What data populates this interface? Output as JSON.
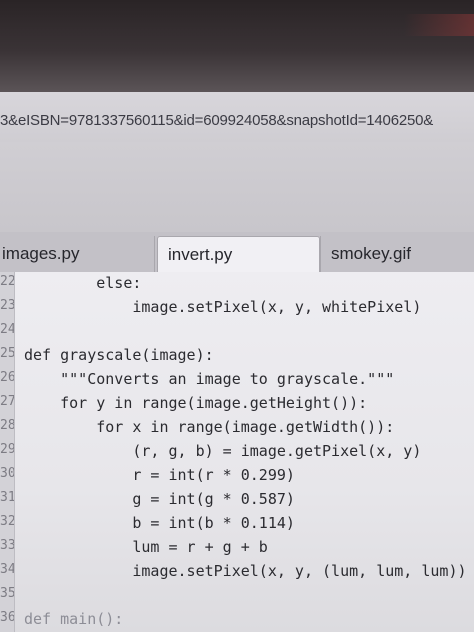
{
  "url": {
    "text": "3&eISBN=9781337560115&id=609924058&snapshotId=1406250&"
  },
  "tabs": [
    {
      "label": "images.py"
    },
    {
      "label": "invert.py"
    },
    {
      "label": "smokey.gif"
    }
  ],
  "editor": {
    "active_tab": "invert.py",
    "lines": [
      {
        "num": "22",
        "text": "        else:"
      },
      {
        "num": "23",
        "text": "            image.setPixel(x, y, whitePixel)"
      },
      {
        "num": "24",
        "text": ""
      },
      {
        "num": "25",
        "text": "def grayscale(image):"
      },
      {
        "num": "26",
        "text": "    \"\"\"Converts an image to grayscale.\"\"\""
      },
      {
        "num": "27",
        "text": "    for y in range(image.getHeight()):"
      },
      {
        "num": "28",
        "text": "        for x in range(image.getWidth()):"
      },
      {
        "num": "29",
        "text": "            (r, g, b) = image.getPixel(x, y)"
      },
      {
        "num": "30",
        "text": "            r = int(r * 0.299)"
      },
      {
        "num": "31",
        "text": "            g = int(g * 0.587)"
      },
      {
        "num": "32",
        "text": "            b = int(b * 0.114)"
      },
      {
        "num": "33",
        "text": "            lum = r + g + b"
      },
      {
        "num": "34",
        "text": "            image.setPixel(x, y, (lum, lum, lum))"
      },
      {
        "num": "35",
        "text": ""
      },
      {
        "num": "36",
        "text": "def main():"
      }
    ]
  }
}
